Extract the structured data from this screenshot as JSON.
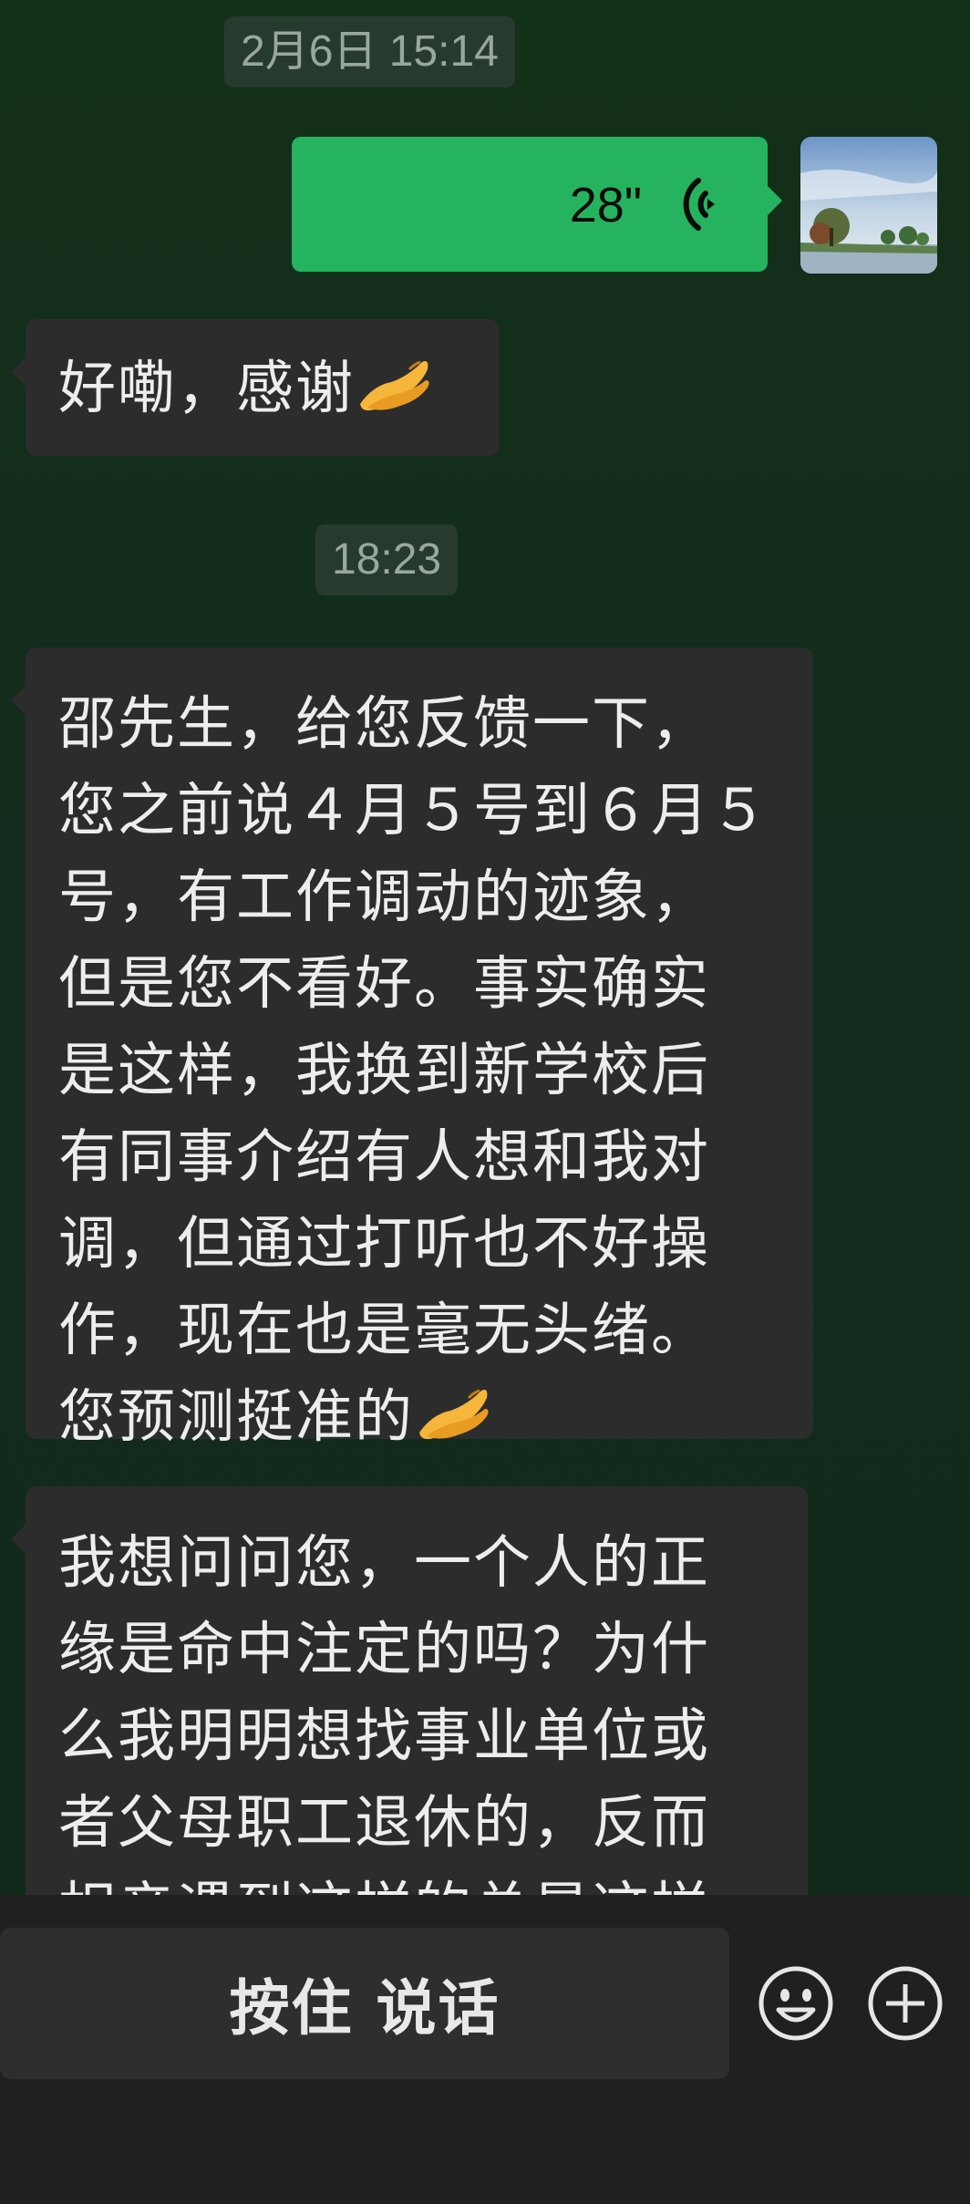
{
  "timestamps": {
    "first": "2月6日 15:14",
    "second": "18:23"
  },
  "voice_message": {
    "duration": "28\"",
    "icon": "voice-wave-icon",
    "bubble_color": "#25b35f"
  },
  "messages": {
    "m1": {
      "text": "好嘞，感谢",
      "emoji": "pinched-fingers-emoji"
    },
    "m2": {
      "lines": [
        "邵先生，给您反馈一下，",
        "您之前说４月５号到６月５",
        "号，有工作调动的迹象，",
        "但是您不看好。事实确实",
        "是这样，我换到新学校后",
        "有同事介绍有人想和我对",
        "调，但通过打听也不好操",
        "作，现在也是毫无头绪。"
      ],
      "last_line": "您预测挺准的",
      "emoji": "pinched-fingers-emoji"
    },
    "m3": {
      "lines": [
        "我想问问您，一个人的正",
        "缘是命中注定的吗？为什",
        "么我明明想找事业单位或",
        "者父母职工退休的，反而",
        "相亲遇到这样的总是这样"
      ]
    }
  },
  "input_bar": {
    "hold_to_talk": "按住 说话",
    "emoji_button_icon": "smiley-icon",
    "plus_button_icon": "plus-icon"
  },
  "colors": {
    "chat_background": "#132a1d",
    "incoming_bubble": "#2c2c2c",
    "bottom_bar": "#202020"
  }
}
